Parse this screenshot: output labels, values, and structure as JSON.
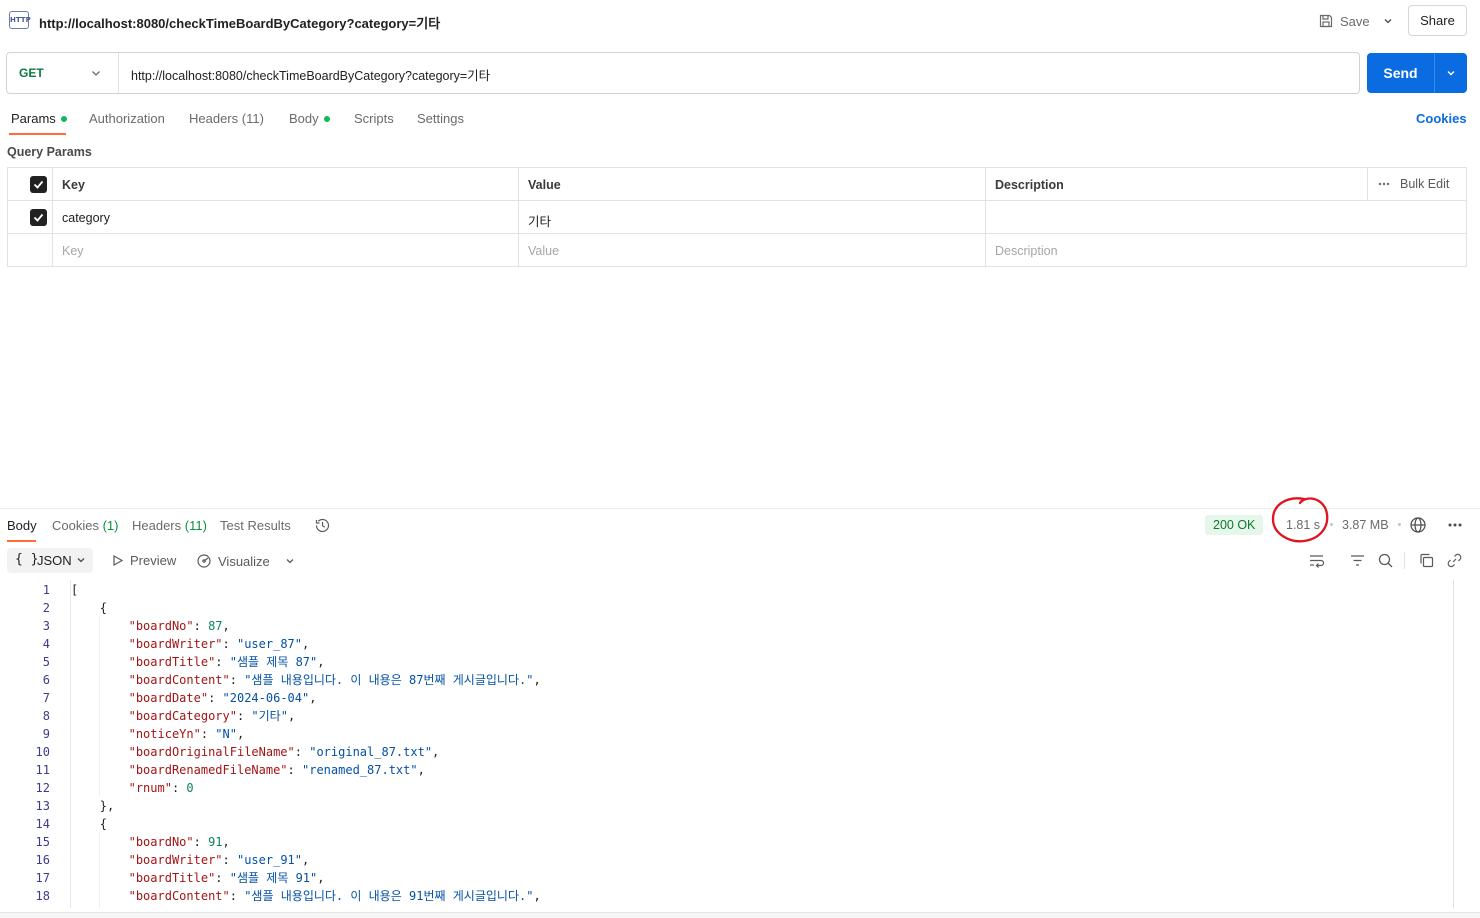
{
  "header": {
    "icon": "http-file-icon",
    "icon_text": "HTTP",
    "title": "http://localhost:8080/checkTimeBoardByCategory?category=기타",
    "save_label": "Save",
    "share_label": "Share"
  },
  "request": {
    "method": "GET",
    "url": "http://localhost:8080/checkTimeBoardByCategory?category=기타",
    "send_label": "Send",
    "method_color": "#0c7a43",
    "send_color": "#0b6be0"
  },
  "tabs": {
    "items": [
      {
        "label": "Params",
        "active": true,
        "dot": true
      },
      {
        "label": "Authorization"
      },
      {
        "label": "Headers",
        "count": "(11)"
      },
      {
        "label": "Body",
        "dot": true
      },
      {
        "label": "Scripts"
      },
      {
        "label": "Settings"
      }
    ],
    "cookies_label": "Cookies",
    "accent_color": "#ff6c37"
  },
  "query_params": {
    "section_label": "Query Params",
    "columns": [
      "Key",
      "Value",
      "Description"
    ],
    "bulk_edit_label": "Bulk Edit",
    "rows": [
      {
        "checked": true,
        "key": "category",
        "value": "기타",
        "description": ""
      }
    ],
    "placeholder": {
      "key": "Key",
      "value": "Value",
      "description": "Description"
    }
  },
  "response": {
    "tabs": [
      {
        "label": "Body",
        "active": true
      },
      {
        "label": "Cookies",
        "count": "(1)"
      },
      {
        "label": "Headers",
        "count": "(11)"
      },
      {
        "label": "Test Results"
      }
    ],
    "status": "200 OK",
    "time": "1.81 s",
    "size": "3.87 MB",
    "annotation_color": "#e0141e",
    "format": {
      "braces": "{ }",
      "label": "JSON"
    },
    "preview_label": "Preview",
    "visualize_label": "Visualize",
    "lines": [
      {
        "n": "1",
        "indent": 0,
        "text": "["
      },
      {
        "n": "2",
        "indent": 1,
        "text": "{"
      },
      {
        "n": "3",
        "indent": 2,
        "key": "boardNo",
        "num": "87"
      },
      {
        "n": "4",
        "indent": 2,
        "key": "boardWriter",
        "str": "user_87"
      },
      {
        "n": "5",
        "indent": 2,
        "key": "boardTitle",
        "str": "샘플 제목 87"
      },
      {
        "n": "6",
        "indent": 2,
        "key": "boardContent",
        "str": "샘플 내용입니다. 이 내용은 87번째 게시글입니다."
      },
      {
        "n": "7",
        "indent": 2,
        "key": "boardDate",
        "str": "2024-06-04"
      },
      {
        "n": "8",
        "indent": 2,
        "key": "boardCategory",
        "str": "기타"
      },
      {
        "n": "9",
        "indent": 2,
        "key": "noticeYn",
        "str": "N"
      },
      {
        "n": "10",
        "indent": 2,
        "key": "boardOriginalFileName",
        "str": "original_87.txt"
      },
      {
        "n": "11",
        "indent": 2,
        "key": "boardRenamedFileName",
        "str": "renamed_87.txt"
      },
      {
        "n": "12",
        "indent": 2,
        "key": "rnum",
        "num": "0",
        "last": true
      },
      {
        "n": "13",
        "indent": 1,
        "text": "},"
      },
      {
        "n": "14",
        "indent": 1,
        "text": "{"
      },
      {
        "n": "15",
        "indent": 2,
        "key": "boardNo",
        "num": "91"
      },
      {
        "n": "16",
        "indent": 2,
        "key": "boardWriter",
        "str": "user_91"
      },
      {
        "n": "17",
        "indent": 2,
        "key": "boardTitle",
        "str": "샘플 제목 91"
      },
      {
        "n": "18",
        "indent": 2,
        "key": "boardContent",
        "str": "샘플 내용입니다. 이 내용은 91번째 게시글입니다."
      }
    ]
  }
}
